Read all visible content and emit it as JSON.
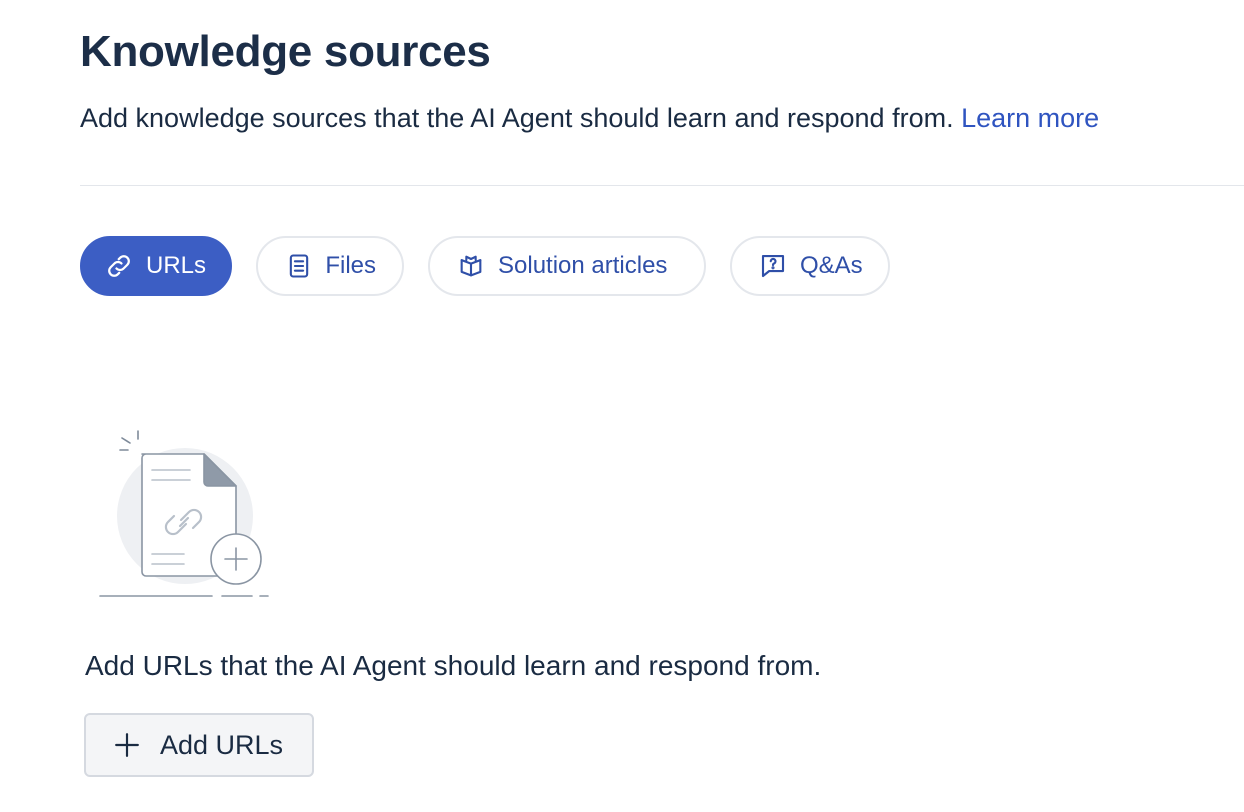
{
  "header": {
    "title": "Knowledge sources",
    "subtitle": "Add knowledge sources that the AI Agent should learn and respond from.",
    "learn_more": "Learn more"
  },
  "tabs": [
    {
      "label": "URLs",
      "icon": "link-icon",
      "active": true
    },
    {
      "label": "Files",
      "icon": "document-icon",
      "active": false
    },
    {
      "label": "Solution articles",
      "icon": "book-icon",
      "active": false
    },
    {
      "label": "Q&As",
      "icon": "chat-question-icon",
      "active": false
    }
  ],
  "empty_state": {
    "illustration": "document-link-add-icon",
    "message": "Add URLs that the AI Agent should learn and respond from.",
    "button_label": "Add URLs",
    "button_icon": "plus-icon"
  },
  "colors": {
    "accent": "#3c5ec4",
    "link": "#2f54c0",
    "text": "#1a2b42"
  }
}
